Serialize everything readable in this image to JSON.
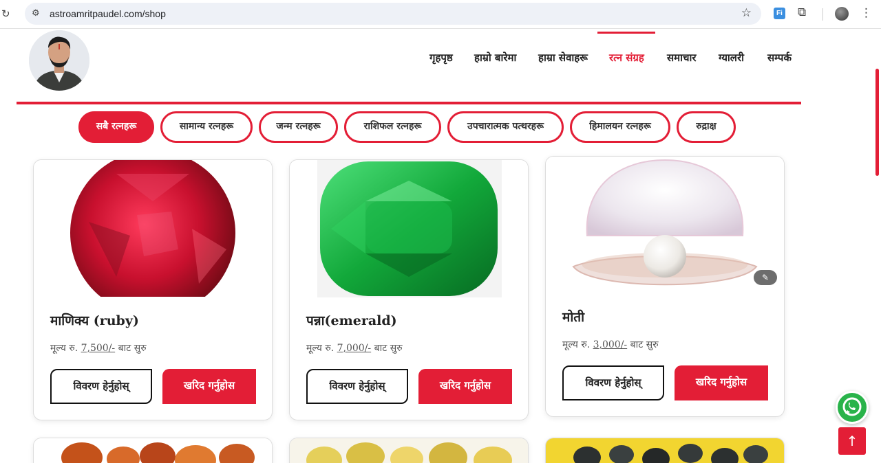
{
  "browser": {
    "url": "astroamritpaudel.com/shop",
    "reload_icon": "↻",
    "site_info_icon": "⚙",
    "bookmark_icon": "☆",
    "extension_badge": "Fi",
    "extensions_icon": "⧉",
    "menu_icon": "⋮"
  },
  "nav": {
    "items": [
      {
        "label": "गृहपृष्ठ"
      },
      {
        "label": "हाम्रो बारेमा"
      },
      {
        "label": "हाम्रा सेवाहरू"
      },
      {
        "label": "रत्न संग्रह"
      },
      {
        "label": "समाचार"
      },
      {
        "label": "ग्यालरी"
      },
      {
        "label": "सम्पर्क"
      }
    ],
    "active_index": 3
  },
  "filters": [
    {
      "label": "सबै रत्नहरू"
    },
    {
      "label": "सामान्य रत्नहरू"
    },
    {
      "label": "जन्म रत्नहरू"
    },
    {
      "label": "राशिफल रत्नहरू"
    },
    {
      "label": "उपचारात्मक पत्थरहरू"
    },
    {
      "label": "हिमालयन रत्नहरू"
    },
    {
      "label": "रुद्राक्ष"
    }
  ],
  "products": [
    {
      "title": "माणिक्य (ruby)",
      "price_prefix": "मूल्य रु.",
      "price": "7,500/-",
      "price_suffix": "बाट सुरु",
      "detail_label": "विवरण हेर्नुहोस्",
      "buy_label": "खरिद गर्नुहोस"
    },
    {
      "title": "पन्ना(emerald)",
      "price_prefix": "मूल्य रु.",
      "price": "7,000/-",
      "price_suffix": "बाट सुरु",
      "detail_label": "विवरण हेर्नुहोस्",
      "buy_label": "खरिद गर्नुहोस"
    },
    {
      "title": "मोती",
      "price_prefix": "मूल्य रु.",
      "price": "3,000/-",
      "price_suffix": "बाट सुरु",
      "detail_label": "विवरण हेर्नुहोस्",
      "buy_label": "खरिद गर्नुहोस"
    }
  ],
  "floating": {
    "back_to_top_icon": "↑"
  },
  "colors": {
    "accent": "#e31e36",
    "whatsapp": "#29b34a"
  }
}
